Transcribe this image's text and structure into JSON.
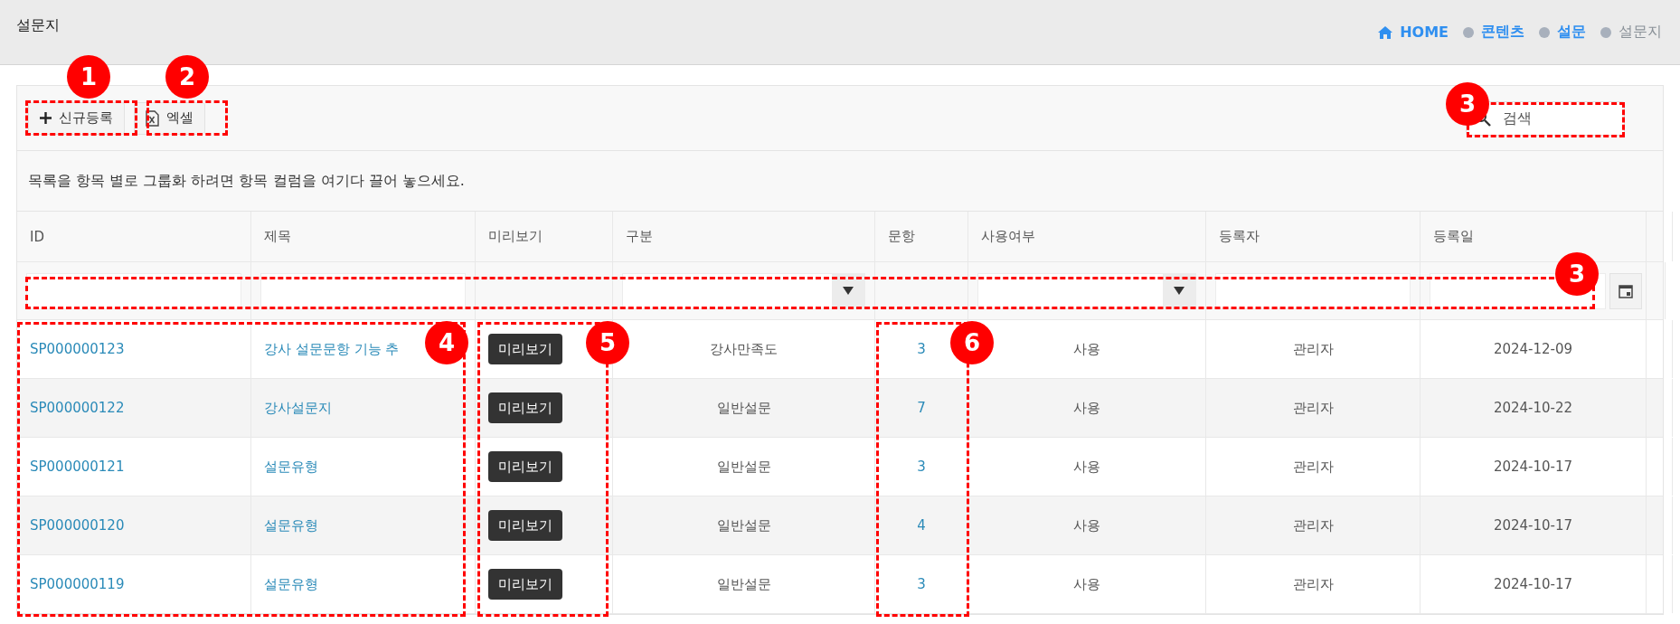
{
  "page_title": "설문지",
  "breadcrumb": [
    {
      "label": "HOME",
      "kind": "home",
      "selected": false
    },
    {
      "label": "콘텐츠",
      "kind": "item",
      "selected": false
    },
    {
      "label": "설문",
      "kind": "item",
      "selected": false
    },
    {
      "label": "설문지",
      "kind": "item",
      "selected": true
    }
  ],
  "toolbar": {
    "new_button": "신규등록",
    "excel_button": "엑셀",
    "search": {
      "placeholder": "검색"
    }
  },
  "group_hint": "목록을 항목 별로 그룹화 하려면 항목 컬럼을 여기다 끌어 놓으세요.",
  "table": {
    "columns": [
      "ID",
      "제목",
      "미리보기",
      "구분",
      "문항",
      "사용여부",
      "등록자",
      "등록일"
    ],
    "filters": [
      {
        "kind": "text"
      },
      {
        "kind": "text"
      },
      {
        "kind": "none"
      },
      {
        "kind": "select"
      },
      {
        "kind": "none"
      },
      {
        "kind": "select"
      },
      {
        "kind": "text"
      },
      {
        "kind": "date"
      }
    ],
    "rows": [
      {
        "id": "SP000000123",
        "title": "강사 설문문항 기능 추",
        "preview": "미리보기",
        "category": "강사만족도",
        "items": "3",
        "use": "사용",
        "author": "관리자",
        "date": "2024-12-09"
      },
      {
        "id": "SP000000122",
        "title": "강사설문지",
        "preview": "미리보기",
        "category": "일반설문",
        "items": "7",
        "use": "사용",
        "author": "관리자",
        "date": "2024-10-22"
      },
      {
        "id": "SP000000121",
        "title": "설문유형",
        "preview": "미리보기",
        "category": "일반설문",
        "items": "3",
        "use": "사용",
        "author": "관리자",
        "date": "2024-10-17"
      },
      {
        "id": "SP000000120",
        "title": "설문유형",
        "preview": "미리보기",
        "category": "일반설문",
        "items": "4",
        "use": "사용",
        "author": "관리자",
        "date": "2024-10-17"
      },
      {
        "id": "SP000000119",
        "title": "설문유형",
        "preview": "미리보기",
        "category": "일반설문",
        "items": "3",
        "use": "사용",
        "author": "관리자",
        "date": "2024-10-17"
      }
    ]
  },
  "callouts": [
    "1",
    "2",
    "3",
    "3",
    "4",
    "5",
    "6"
  ]
}
